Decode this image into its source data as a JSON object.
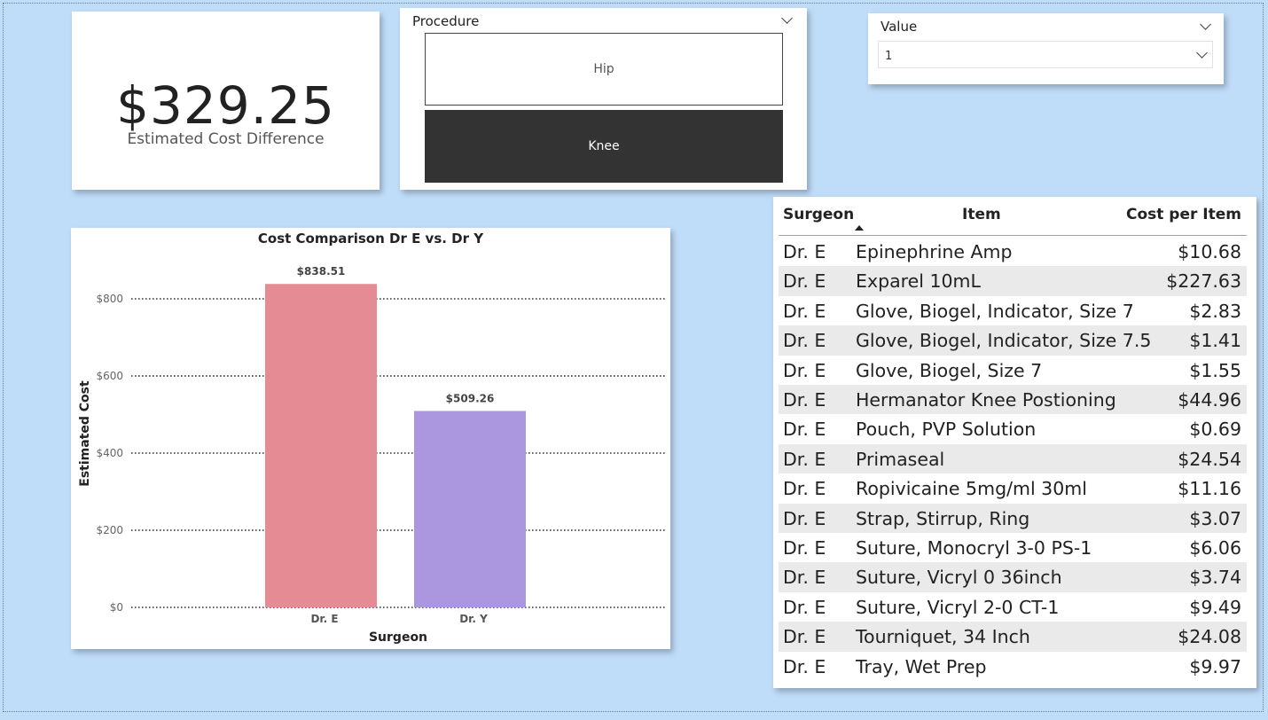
{
  "kpi": {
    "value": "$329.25",
    "label": "Estimated Cost Difference"
  },
  "procedure_slicer": {
    "title": "Procedure",
    "options": [
      {
        "label": "Hip",
        "selected": false
      },
      {
        "label": "Knee",
        "selected": true
      }
    ]
  },
  "value_slicer": {
    "title": "Value",
    "selected": "1"
  },
  "chart_data": {
    "type": "bar",
    "title": "Cost Comparison Dr E vs. Dr Y",
    "xlabel": "Surgeon",
    "ylabel": "Estimated Cost",
    "categories": [
      "Dr. E",
      "Dr. Y"
    ],
    "values": [
      838.51,
      509.26
    ],
    "data_labels": [
      "$838.51",
      "$509.26"
    ],
    "colors": [
      "#e58b94",
      "#ab97df"
    ],
    "ylim": [
      0,
      840
    ],
    "yticks": [
      0,
      200,
      400,
      600,
      800
    ],
    "ytick_labels": [
      "$0",
      "$200",
      "$400",
      "$600",
      "$800"
    ],
    "grid": true
  },
  "table": {
    "headers": {
      "surgeon": "Surgeon",
      "item": "Item",
      "cost": "Cost per Item"
    },
    "sorted_column": "Item",
    "rows": [
      {
        "surgeon": "Dr. E",
        "item": "Epinephrine Amp",
        "cost": "$10.68"
      },
      {
        "surgeon": "Dr. E",
        "item": "Exparel 10mL",
        "cost": "$227.63"
      },
      {
        "surgeon": "Dr. E",
        "item": "Glove, Biogel, Indicator, Size 7",
        "cost": "$2.83"
      },
      {
        "surgeon": "Dr. E",
        "item": "Glove, Biogel, Indicator, Size 7.5",
        "cost": "$1.41"
      },
      {
        "surgeon": "Dr. E",
        "item": "Glove, Biogel, Size 7",
        "cost": "$1.55"
      },
      {
        "surgeon": "Dr. E",
        "item": "Hermanator Knee Postioning",
        "cost": "$44.96"
      },
      {
        "surgeon": "Dr. E",
        "item": "Pouch, PVP Solution",
        "cost": "$0.69"
      },
      {
        "surgeon": "Dr. E",
        "item": "Primaseal",
        "cost": "$24.54"
      },
      {
        "surgeon": "Dr. E",
        "item": "Ropivicaine 5mg/ml 30ml",
        "cost": "$11.16"
      },
      {
        "surgeon": "Dr. E",
        "item": "Strap, Stirrup, Ring",
        "cost": "$3.07"
      },
      {
        "surgeon": "Dr. E",
        "item": "Suture, Monocryl 3-0 PS-1",
        "cost": "$6.06"
      },
      {
        "surgeon": "Dr. E",
        "item": "Suture, Vicryl 0 36inch",
        "cost": "$3.74"
      },
      {
        "surgeon": "Dr. E",
        "item": "Suture, Vicryl 2-0 CT-1",
        "cost": "$9.49"
      },
      {
        "surgeon": "Dr. E",
        "item": "Tourniquet, 34 Inch",
        "cost": "$24.08"
      },
      {
        "surgeon": "Dr. E",
        "item": "Tray, Wet Prep",
        "cost": "$9.97"
      }
    ]
  }
}
